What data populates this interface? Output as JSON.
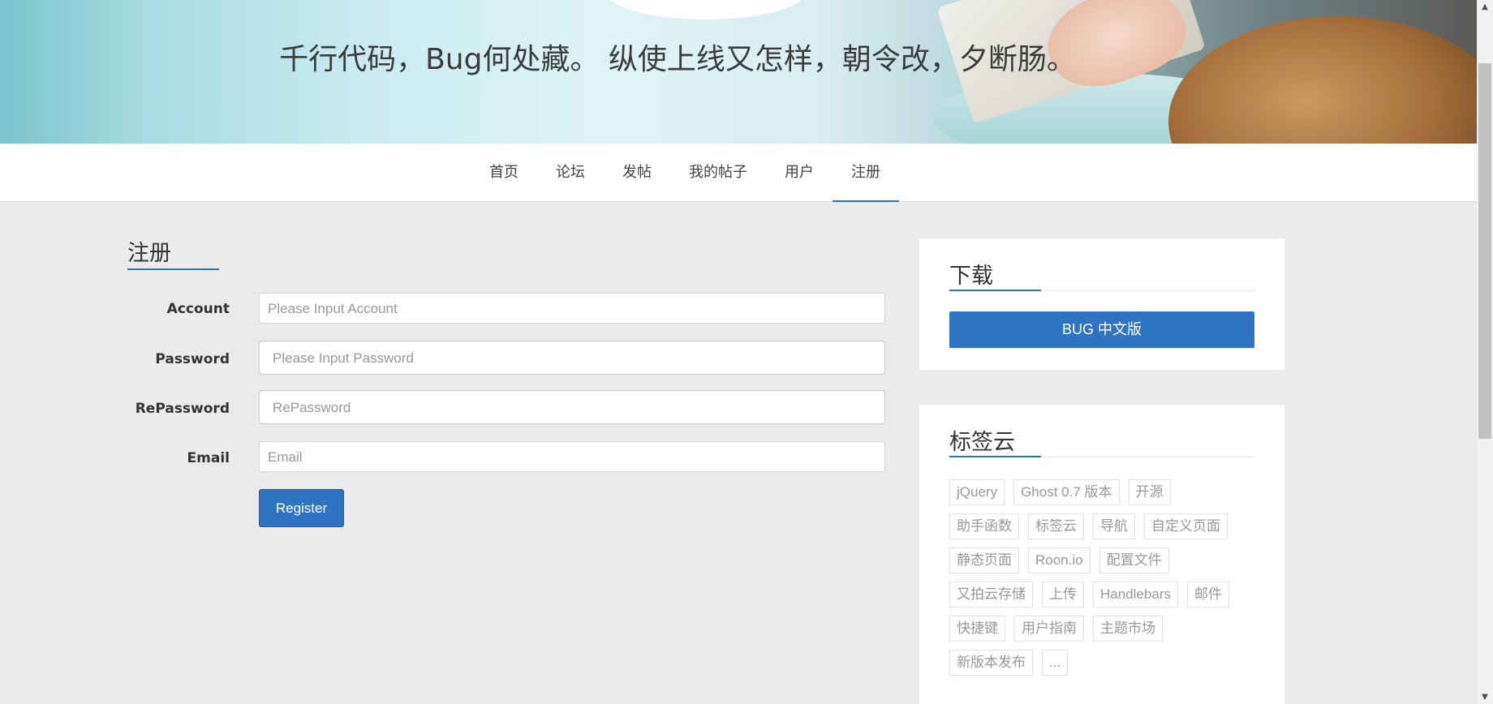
{
  "hero": {
    "slogan": "千行代码，Bug何处藏。 纵使上线又怎样，朝令改，夕断肠。"
  },
  "nav": {
    "items": [
      {
        "label": "首页"
      },
      {
        "label": "论坛"
      },
      {
        "label": "发帖"
      },
      {
        "label": "我的帖子"
      },
      {
        "label": "用户"
      },
      {
        "label": "注册"
      }
    ],
    "active": "注册"
  },
  "register": {
    "title": "注册",
    "fields": [
      {
        "label": "Account",
        "placeholder": "Please Input Account"
      },
      {
        "label": "Password",
        "placeholder": "Please Input Password"
      },
      {
        "label": "RePassword",
        "placeholder": "RePassword"
      },
      {
        "label": "Email",
        "placeholder": "Email"
      }
    ],
    "submit_label": "Register"
  },
  "sidebar": {
    "download": {
      "title": "下载",
      "button_label": "BUG 中文版"
    },
    "tag_cloud": {
      "title": "标签云",
      "tags": [
        "jQuery",
        "Ghost 0.7 版本",
        "开源",
        "助手函数",
        "标签云",
        "导航",
        "自定义页面",
        "静态页面",
        "Roon.io",
        "配置文件",
        "又拍云存储",
        "上传",
        "Handlebars",
        "邮件",
        "快捷键",
        "用户指南",
        "主题市场",
        "新版本发布",
        "..."
      ]
    }
  },
  "colors": {
    "accent": "#2f74c2",
    "background": "#ebebeb"
  }
}
